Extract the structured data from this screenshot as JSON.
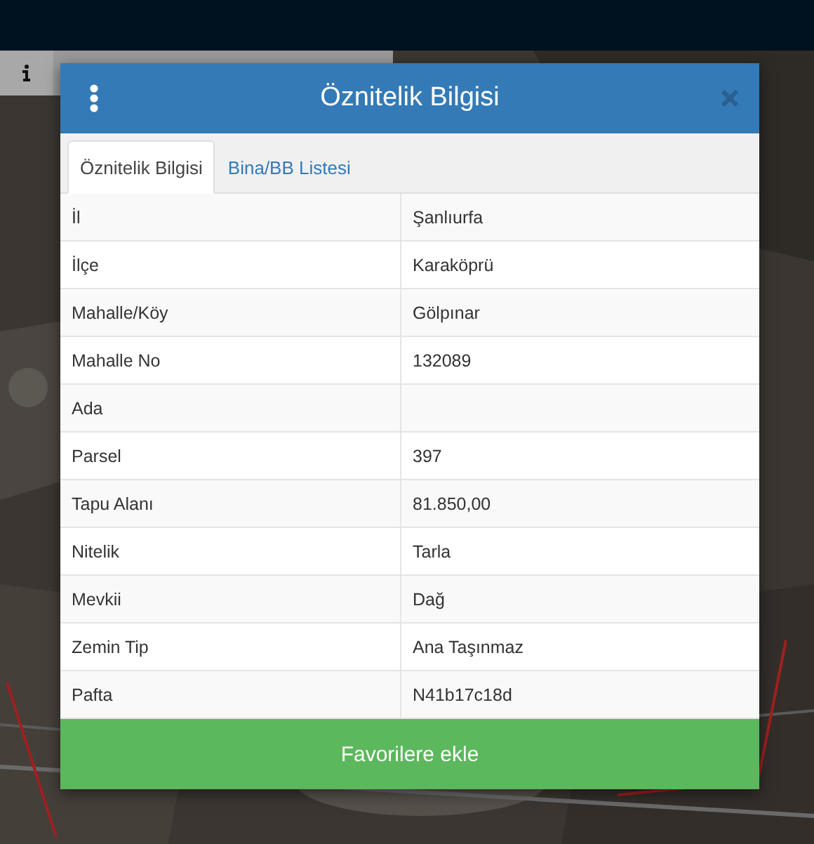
{
  "modal": {
    "title": "Öznitelik Bilgisi"
  },
  "tabs": [
    {
      "label": "Öznitelik Bilgisi",
      "selected": true
    },
    {
      "label": "Bina/BB Listesi",
      "selected": false
    }
  ],
  "rows": [
    {
      "label": "İl",
      "value": "Şanlıurfa"
    },
    {
      "label": "İlçe",
      "value": "Karaköprü"
    },
    {
      "label": "Mahalle/Köy",
      "value": "Gölpınar"
    },
    {
      "label": "Mahalle No",
      "value": "132089"
    },
    {
      "label": "Ada"
    },
    {
      "label": "Parsel",
      "value": "397"
    },
    {
      "label": "Tapu Alanı",
      "value": "81.850,00"
    },
    {
      "label": "Nitelik",
      "value": "Tarla"
    },
    {
      "label": "Mevkii",
      "value": "Dağ"
    },
    {
      "label": "Zemin Tip",
      "value": "Ana Taşınmaz"
    },
    {
      "label": "Pafta",
      "value": "N41b17c18d"
    }
  ],
  "button": {
    "label": "Favorilere ekle"
  }
}
